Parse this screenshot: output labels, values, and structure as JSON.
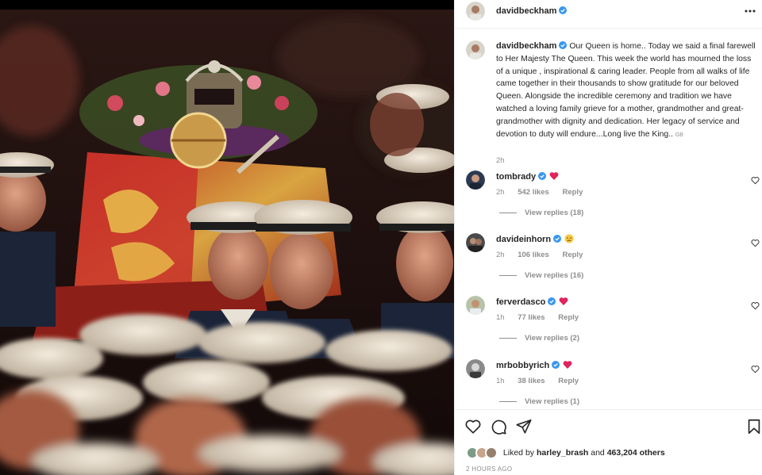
{
  "post": {
    "author": "davidbeckham",
    "caption": "Our Queen is home.. Today we said a final farewell to Her Majesty The Queen. This week the world has mourned the loss of a unique , inspirational & caring leader. People from all walks of life came together in their thousands to show gratitude for our beloved Queen. Alongside the incredible ceremony and tradition we have watched a loving family grieve for a mother, grandmother and great-grandmother with dignity and dedication. Her legacy of service and devotion to duty will endure...Long live the King..",
    "caption_flag": "GB",
    "caption_time": "2h",
    "liked_by_prefix": "Liked by",
    "liked_by_user": "harley_brash",
    "liked_by_and": "and",
    "liked_by_others": "463,204 others",
    "date": "2 HOURS AGO"
  },
  "comments": [
    {
      "user": "tombrady",
      "emoji": "red-heart",
      "time": "2h",
      "likes": "542 likes",
      "reply": "Reply",
      "view_replies": "View replies (18)"
    },
    {
      "user": "davideinhorn",
      "emoji": "sad-face",
      "time": "2h",
      "likes": "106 likes",
      "reply": "Reply",
      "view_replies": "View replies (16)"
    },
    {
      "user": "ferverdasco",
      "emoji": "red-heart",
      "time": "1h",
      "likes": "77 likes",
      "reply": "Reply",
      "view_replies": "View replies (2)"
    },
    {
      "user": "mrbobbyrich",
      "emoji": "red-heart",
      "time": "1h",
      "likes": "38 likes",
      "reply": "Reply",
      "view_replies": "View replies (1)"
    }
  ],
  "icons": {
    "more": "more-options-icon",
    "like": "heart-icon",
    "comment": "comment-icon",
    "share": "share-icon",
    "save": "bookmark-icon",
    "verified": "verified-badge-icon"
  },
  "colors": {
    "verified": "#3897f0",
    "heart": "#ed4956",
    "muted": "#8e8e8e",
    "text": "#262626"
  }
}
